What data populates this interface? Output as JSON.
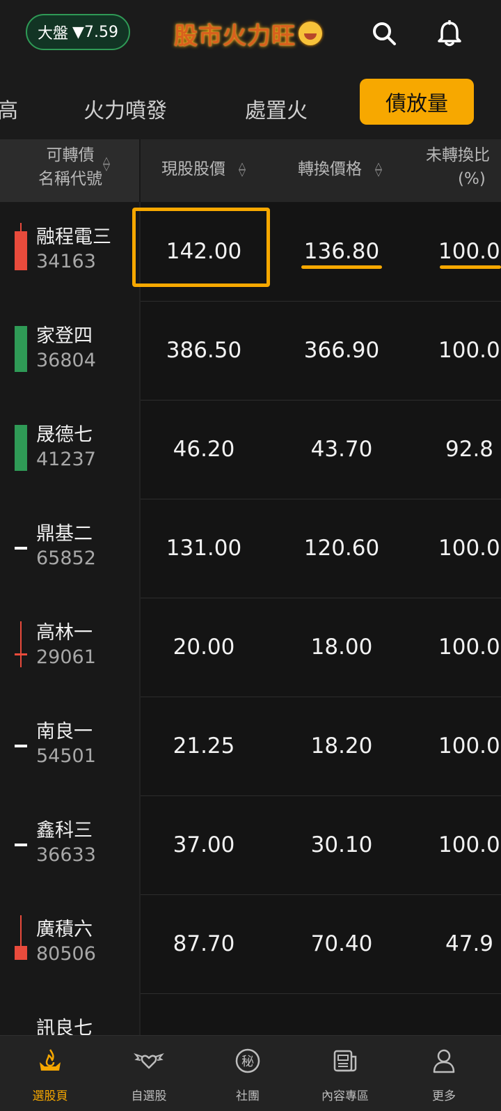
{
  "header": {
    "index_label": "大盤",
    "index_change": "▼7.59",
    "logo_text": "股市火力旺",
    "colors": {
      "accent": "#f7a800",
      "up": "#e94b3c",
      "down": "#2f9a56"
    }
  },
  "tabs": [
    {
      "label": "高",
      "active": false
    },
    {
      "label": "火力噴發",
      "active": false
    },
    {
      "label": "處置火",
      "active": false
    },
    {
      "label": "債放量",
      "active": true
    }
  ],
  "table": {
    "columns": [
      {
        "line1": "可轉債",
        "line2": "名稱代號"
      },
      {
        "line1": "現股股價"
      },
      {
        "line1": "轉換價格"
      },
      {
        "line1": "未轉換比",
        "line2": "(%)"
      }
    ],
    "rows": [
      {
        "name": "融程電三",
        "code": "34163",
        "price": "142.00",
        "conv": "136.80",
        "ratio": "100.0",
        "candle": "red-block"
      },
      {
        "name": "家登四",
        "code": "36804",
        "price": "386.50",
        "conv": "366.90",
        "ratio": "100.0",
        "candle": "green-block"
      },
      {
        "name": "晟德七",
        "code": "41237",
        "price": "46.20",
        "conv": "43.70",
        "ratio": "92.8",
        "candle": "green-block"
      },
      {
        "name": "鼎基二",
        "code": "65852",
        "price": "131.00",
        "conv": "120.60",
        "ratio": "100.0",
        "candle": "flat"
      },
      {
        "name": "高林一",
        "code": "29061",
        "price": "20.00",
        "conv": "18.00",
        "ratio": "100.0",
        "candle": "red-cross"
      },
      {
        "name": "南良一",
        "code": "54501",
        "price": "21.25",
        "conv": "18.20",
        "ratio": "100.0",
        "candle": "flat"
      },
      {
        "name": "鑫科三",
        "code": "36633",
        "price": "37.00",
        "conv": "30.10",
        "ratio": "100.0",
        "candle": "flat"
      },
      {
        "name": "廣積六",
        "code": "80506",
        "price": "87.70",
        "conv": "70.40",
        "ratio": "47.9",
        "candle": "red-small"
      },
      {
        "name": "訊良七",
        "code": "",
        "price": "",
        "conv": "",
        "ratio": "",
        "candle": "none"
      }
    ]
  },
  "nav": [
    {
      "label": "選股頁",
      "icon": "fire-hand-icon",
      "active": true
    },
    {
      "label": "自選股",
      "icon": "winged-heart-icon",
      "active": false
    },
    {
      "label": "社團",
      "icon": "secret-badge-icon",
      "active": false
    },
    {
      "label": "內容專區",
      "icon": "newspaper-icon",
      "active": false
    },
    {
      "label": "更多",
      "icon": "person-icon",
      "active": false
    }
  ]
}
